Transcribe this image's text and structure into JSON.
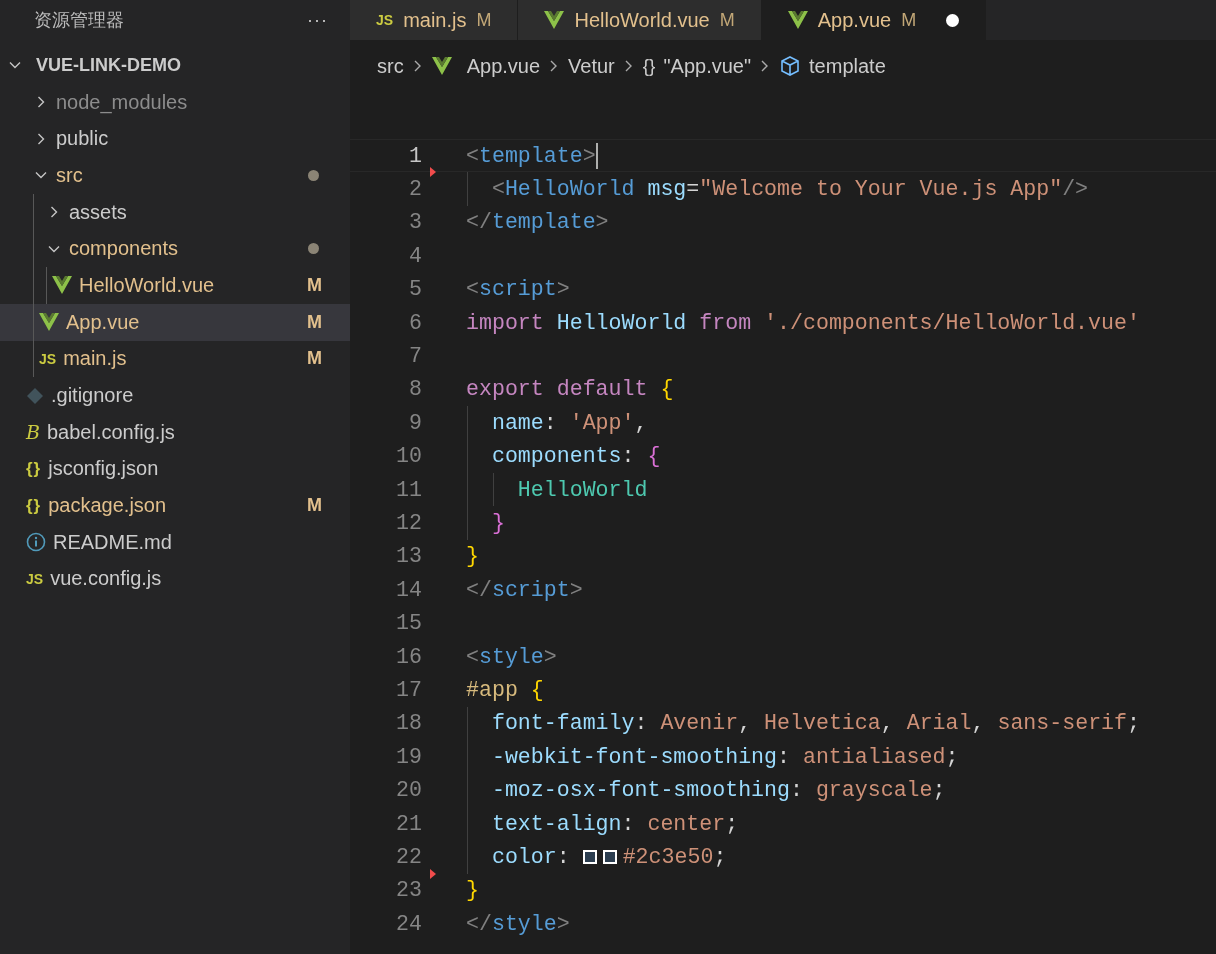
{
  "sidebar": {
    "title": "资源管理器",
    "more": "···",
    "root": {
      "name": "VUE-LINK-DEMO",
      "expanded": true
    },
    "items": [
      {
        "name": "node_modules",
        "kind": "folder",
        "expanded": false,
        "ignored": true,
        "selected": false,
        "has_changes": false
      },
      {
        "name": "public",
        "kind": "folder",
        "expanded": false,
        "ignored": false,
        "selected": false,
        "has_changes": false
      },
      {
        "name": "src",
        "kind": "folder",
        "expanded": true,
        "ignored": false,
        "selected": false,
        "has_changes": true,
        "children": [
          {
            "name": "assets",
            "kind": "folder",
            "expanded": false,
            "ignored": false,
            "selected": false,
            "has_changes": false
          },
          {
            "name": "components",
            "kind": "folder",
            "expanded": true,
            "ignored": false,
            "selected": false,
            "has_changes": true,
            "children": [
              {
                "name": "HelloWorld.vue",
                "kind": "vue",
                "ignored": false,
                "selected": false,
                "badge": "M"
              }
            ]
          },
          {
            "name": "App.vue",
            "kind": "vue",
            "ignored": false,
            "selected": true,
            "badge": "M"
          },
          {
            "name": "main.js",
            "kind": "js",
            "icon_text": "JS",
            "ignored": false,
            "selected": false,
            "badge": "M"
          }
        ]
      },
      {
        "name": ".gitignore",
        "kind": "git",
        "ignored": false,
        "selected": false
      },
      {
        "name": "babel.config.js",
        "kind": "babel",
        "icon_text": "B",
        "ignored": false,
        "selected": false
      },
      {
        "name": "jsconfig.json",
        "kind": "json",
        "icon_text": "{}",
        "ignored": false,
        "selected": false
      },
      {
        "name": "package.json",
        "kind": "json",
        "icon_text": "{}",
        "ignored": false,
        "selected": false,
        "badge": "M"
      },
      {
        "name": "README.md",
        "kind": "info",
        "ignored": false,
        "selected": false
      },
      {
        "name": "vue.config.js",
        "kind": "js",
        "icon_text": "JS",
        "ignored": false,
        "selected": false
      }
    ]
  },
  "tabs": [
    {
      "label": "main.js",
      "kind": "js",
      "icon_text": "JS",
      "badge": "M",
      "selected": false,
      "unsaved": false
    },
    {
      "label": "HelloWorld.vue",
      "kind": "vue",
      "badge": "M",
      "selected": false,
      "unsaved": false
    },
    {
      "label": "App.vue",
      "kind": "vue",
      "badge": "M",
      "selected": true,
      "unsaved": true
    }
  ],
  "breadcrumbs": [
    {
      "label": "src",
      "kind": "plain"
    },
    {
      "label": "App.vue",
      "kind": "vue"
    },
    {
      "label": "Vetur",
      "kind": "plain"
    },
    {
      "label": "\"App.vue\"",
      "kind": "braces",
      "icon_text": "{}"
    },
    {
      "label": "template",
      "kind": "cube"
    }
  ],
  "editor": {
    "lines": [
      {
        "number": "1",
        "kind": "html",
        "current": true,
        "deleted_below": true,
        "text": "<template>"
      },
      {
        "number": "2",
        "kind": "html",
        "current": false,
        "deleted_below": false,
        "text": "  <HelloWorld msg=\"Welcome to Your Vue.js App\"/>"
      },
      {
        "number": "3",
        "kind": "html",
        "current": false,
        "deleted_below": false,
        "text": "</template>"
      },
      {
        "number": "4",
        "kind": "html",
        "current": false,
        "deleted_below": false
      },
      {
        "number": "5",
        "kind": "html",
        "current": false,
        "deleted_below": false,
        "text": "<script>"
      },
      {
        "number": "6",
        "kind": "js",
        "current": false,
        "deleted_below": false,
        "text": "import HelloWorld from './components/HelloWorld.vue'"
      },
      {
        "number": "7",
        "kind": "js",
        "current": false,
        "deleted_below": false
      },
      {
        "number": "8",
        "kind": "js",
        "current": false,
        "deleted_below": false,
        "text": "export default {"
      },
      {
        "number": "9",
        "kind": "js",
        "current": false,
        "deleted_below": false,
        "text": "  name: 'App',"
      },
      {
        "number": "10",
        "kind": "js",
        "current": false,
        "deleted_below": false,
        "text": "  components: {"
      },
      {
        "number": "11",
        "kind": "js",
        "current": false,
        "deleted_below": false,
        "text": "    HelloWorld"
      },
      {
        "number": "12",
        "kind": "js",
        "current": false,
        "deleted_below": false,
        "text": "  }"
      },
      {
        "number": "13",
        "kind": "js",
        "current": false,
        "deleted_below": false,
        "text": "}"
      },
      {
        "number": "14",
        "kind": "html",
        "current": false,
        "deleted_below": false,
        "text": "</script>"
      },
      {
        "number": "15",
        "kind": "html",
        "current": false,
        "deleted_below": false
      },
      {
        "number": "16",
        "kind": "html",
        "current": false,
        "deleted_below": false,
        "text": "<style>"
      },
      {
        "number": "17",
        "kind": "css",
        "current": false,
        "deleted_below": false,
        "text": "#app {"
      },
      {
        "number": "18",
        "kind": "css",
        "current": false,
        "deleted_below": false,
        "text": "  font-family: Avenir, Helvetica, Arial, sans-serif;"
      },
      {
        "number": "19",
        "kind": "css",
        "current": false,
        "deleted_below": false,
        "text": "  -webkit-font-smoothing: antialiased;"
      },
      {
        "number": "20",
        "kind": "css",
        "current": false,
        "deleted_below": false,
        "text": "  -moz-osx-font-smoothing: grayscale;"
      },
      {
        "number": "21",
        "kind": "css",
        "current": false,
        "deleted_below": false,
        "text": "  text-align: center;"
      },
      {
        "number": "22",
        "kind": "css",
        "current": false,
        "deleted_below": true,
        "text": "  color: #2c3e50;",
        "swatches": [
          {
            "color": "#2c3e50"
          },
          {
            "color": "#2c3e50"
          }
        ]
      },
      {
        "number": "23",
        "kind": "css",
        "current": false,
        "deleted_below": false,
        "text": "}"
      },
      {
        "number": "24",
        "kind": "html",
        "current": false,
        "deleted_below": false,
        "text": "</style>"
      }
    ]
  }
}
